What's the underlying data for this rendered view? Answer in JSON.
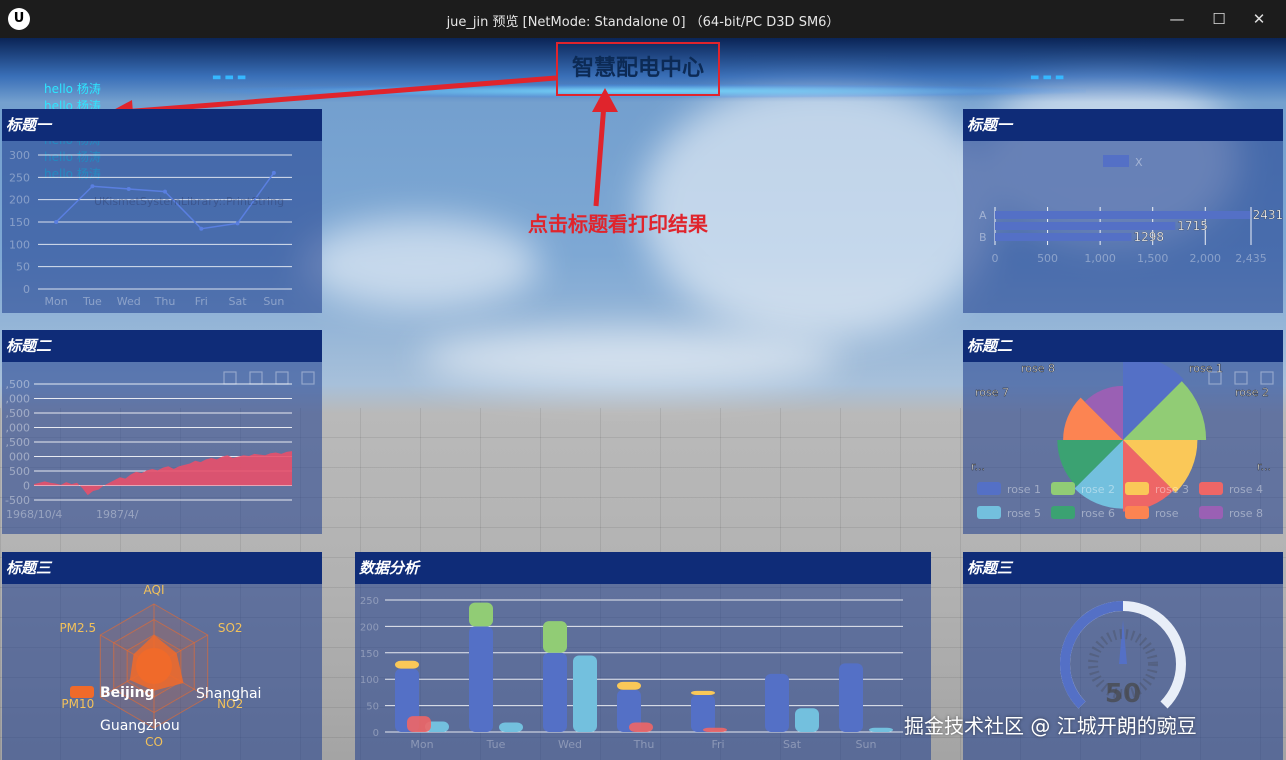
{
  "window": {
    "logo": "U",
    "title": "jue_jin 预览 [NetMode: Standalone 0]  （64-bit/PC D3D SM6）",
    "icons": [
      "minimize-icon",
      "maximize-icon",
      "close-icon"
    ],
    "minimize_glyph": "—",
    "maximize_glyph": "☐",
    "close_glyph": "✕"
  },
  "hud": {
    "main_title": "智慧配电中心",
    "annotation": "点击标题看打印结果",
    "hello_lines": [
      "hello 杨涛",
      "hello 杨涛",
      "hello 杨涛",
      "hello 杨涛",
      "hello 杨涛",
      "hello 杨涛"
    ],
    "watermark": "掘金技术社区 @ 江城开朗的豌豆",
    "colors": {
      "title_border": "#e0242c",
      "panel_header": "#0f2c78",
      "hello_text": "#2ee6ff"
    }
  },
  "panels": {
    "top_left": {
      "title": "标题一",
      "chart_data": {
        "type": "line",
        "categories": [
          "Mon",
          "Tue",
          "Wed",
          "Thu",
          "Fri",
          "Sat",
          "Sun"
        ],
        "values": [
          150,
          230,
          224,
          218,
          135,
          147,
          260
        ],
        "ylim": [
          0,
          300
        ],
        "yticks": [
          "0",
          "50",
          "100",
          "150",
          "200",
          "250",
          "300"
        ],
        "overlay_text": "UKismetSystemLibrary::PrintString"
      }
    },
    "mid_left": {
      "title": "标题二",
      "chart_data": {
        "type": "area",
        "ytick_labels": [
          ",500",
          ",000",
          ",500",
          ",000",
          ",500",
          "000",
          "500",
          "0",
          "-500"
        ],
        "x_labels": [
          "1968/10/4",
          "1987/4/"
        ],
        "color": "#e8506a",
        "series_shape": [
          290,
          300,
          310,
          300,
          295,
          285,
          305,
          290,
          300,
          260,
          210,
          240,
          250,
          280,
          300,
          320,
          340,
          330,
          360,
          380,
          370,
          390,
          400,
          390,
          410,
          420,
          400,
          420,
          430,
          440,
          460,
          450,
          470,
          480,
          470,
          490,
          500,
          480,
          490,
          500,
          495,
          510,
          505,
          500,
          515,
          520,
          510,
          525,
          530
        ]
      }
    },
    "bottom_left": {
      "title": "标题三",
      "chart_data": {
        "type": "radar",
        "indicators": [
          "AQI",
          "SO2",
          "NO2",
          "CO",
          "PM10",
          "PM2.5"
        ],
        "legend": [
          "Beijing",
          "Shanghai",
          "Guangzhou"
        ],
        "color": "#f06a2a"
      }
    },
    "top_right": {
      "title": "标题一",
      "chart_data": {
        "type": "bar",
        "orientation": "horizontal",
        "legend": [
          "X"
        ],
        "categories": [
          "A",
          "B"
        ],
        "series": [
          {
            "name": "X",
            "values": [
              2431,
              1715,
              1298
            ]
          }
        ],
        "labels": [
          "2431",
          "1715",
          "1298"
        ],
        "xticks": [
          "0",
          "500",
          "1,000",
          "1,500",
          "2,000",
          "2,435"
        ],
        "xlim": [
          0,
          2435
        ]
      }
    },
    "mid_right": {
      "title": "标题二",
      "chart_data": {
        "type": "pie",
        "rose": true,
        "labels": [
          "rose 1",
          "rose 2",
          "rose 3",
          "rose 4",
          "rose 5",
          "rose 6",
          "rose 7",
          "rose 8"
        ],
        "values": [
          40,
          38,
          32,
          30,
          28,
          26,
          22,
          18
        ],
        "colors": [
          "#5470c6",
          "#91cc75",
          "#fac858",
          "#ee6666",
          "#73c0de",
          "#3ba272",
          "#fc8452",
          "#9a60b4"
        ],
        "outer_labels": [
          "rose 8",
          "rose 1",
          "rose 7",
          "rose 2",
          "r...",
          "r..."
        ],
        "legend": [
          "rose 1",
          "rose 2",
          "rose 3",
          "rose 4",
          "rose 5",
          "rose 6",
          "rose 7",
          "rose 8"
        ],
        "legend_short": [
          "rose 1",
          "rose 2",
          "rose 3",
          "rose 4",
          "rose 5",
          "rose 6",
          "rose",
          "rose 8"
        ]
      }
    },
    "bottom_center": {
      "title": "数据分析",
      "chart_data": {
        "type": "bar",
        "stacked": true,
        "categories": [
          "Mon",
          "Tue",
          "Wed",
          "Thu",
          "Fri",
          "Sat",
          "Sun"
        ],
        "yticks": [
          "0",
          "50",
          "100",
          "150",
          "200",
          "250"
        ],
        "ylim": [
          0,
          250
        ],
        "series": [
          {
            "name": "",
            "color": "#5470c6",
            "values": [
              120,
              200,
              150,
              80,
              70,
              110,
              130
            ]
          },
          {
            "name": "",
            "color": "#fac858",
            "values": [
              15,
              0,
              0,
              15,
              8,
              0,
              0
            ]
          },
          {
            "name": "",
            "color": "#91cc75",
            "values": [
              0,
              45,
              60,
              0,
              0,
              0,
              0
            ]
          },
          {
            "name": "",
            "color": "#73c0de",
            "values": [
              20,
              18,
              145,
              0,
              0,
              45,
              8
            ]
          },
          {
            "name": "",
            "color": "#ee6666",
            "values": [
              30,
              0,
              0,
              18,
              8,
              0,
              0
            ]
          }
        ]
      }
    },
    "bottom_right": {
      "title": "标题三",
      "chart_data": {
        "type": "gauge",
        "value": 50,
        "label": "50",
        "max": 100
      }
    }
  }
}
